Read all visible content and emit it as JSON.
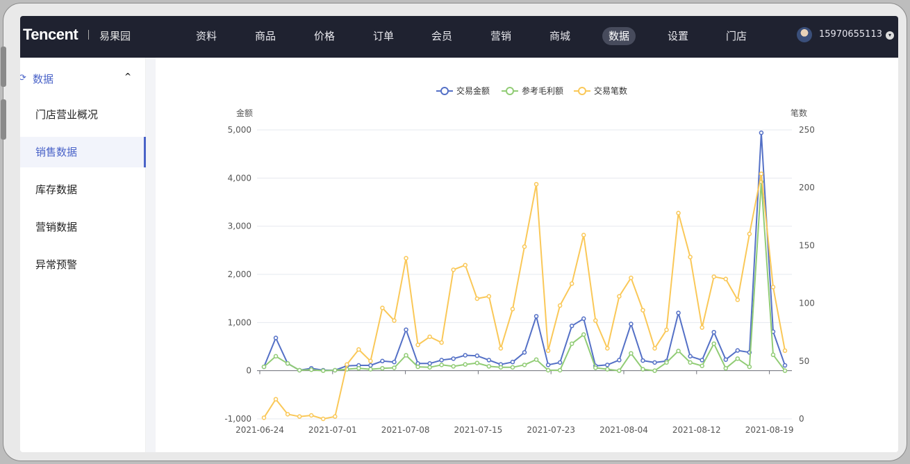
{
  "header": {
    "logo": "Tencent",
    "store_name": "易果园",
    "nav": [
      "资料",
      "商品",
      "价格",
      "订单",
      "会员",
      "营销",
      "商城",
      "数据",
      "设置",
      "门店"
    ],
    "active_nav": "数据",
    "user_phone": "15970655113"
  },
  "sidebar": {
    "section_label": "数据",
    "items": [
      "门店营业概况",
      "销售数据",
      "库存数据",
      "营销数据",
      "异常预警"
    ],
    "active_item": "销售数据"
  },
  "colors": {
    "accent": "#4a63c8",
    "series_amount": "#5470c6",
    "series_profit": "#91cc75",
    "series_count": "#fac858"
  },
  "chart_data": {
    "type": "line",
    "title": "",
    "ylabel_left": "金额",
    "ylabel_right": "笔数",
    "ylim_left": [
      -1000,
      5000
    ],
    "ylim_right": [
      0,
      250
    ],
    "yticks_left": [
      "5,000",
      "4,000",
      "3,000",
      "2,000",
      "1,000",
      "0",
      "-1,000"
    ],
    "yticks_right": [
      "250",
      "200",
      "150",
      "100",
      "50",
      "0"
    ],
    "x_tick_labels": [
      "2021-06-24",
      "2021-07-01",
      "2021-07-08",
      "2021-07-15",
      "2021-07-23",
      "2021-08-04",
      "2021-08-12",
      "2021-08-19"
    ],
    "legend": [
      "交易金额",
      "参考毛利额",
      "交易笔数"
    ],
    "legend_position": "top-center",
    "grid": true,
    "series": [
      {
        "name": "交易金额",
        "axis": "left",
        "values": [
          80,
          680,
          150,
          10,
          50,
          10,
          10,
          100,
          110,
          110,
          200,
          180,
          850,
          150,
          150,
          220,
          250,
          320,
          310,
          220,
          130,
          180,
          380,
          1130,
          120,
          170,
          930,
          1080,
          100,
          120,
          220,
          970,
          210,
          170,
          200,
          1200,
          300,
          220,
          800,
          230,
          420,
          380,
          4940,
          810,
          110
        ]
      },
      {
        "name": "参考毛利额",
        "axis": "left",
        "values": [
          80,
          300,
          150,
          10,
          20,
          0,
          10,
          30,
          50,
          30,
          50,
          60,
          320,
          80,
          70,
          120,
          90,
          130,
          160,
          90,
          70,
          70,
          120,
          230,
          10,
          10,
          560,
          750,
          60,
          30,
          0,
          360,
          30,
          0,
          170,
          410,
          170,
          100,
          560,
          50,
          250,
          80,
          3920,
          330,
          0
        ]
      },
      {
        "name": "交易笔数",
        "axis": "right",
        "values": [
          1,
          17,
          4,
          2,
          3,
          0,
          2,
          47,
          60,
          50,
          96,
          85,
          139,
          64,
          71,
          66,
          129,
          133,
          104,
          106,
          61,
          95,
          149,
          203,
          59,
          98,
          117,
          159,
          85,
          61,
          106,
          122,
          94,
          61,
          77,
          178,
          140,
          79,
          123,
          121,
          103,
          160,
          212,
          114,
          59
        ]
      }
    ]
  }
}
